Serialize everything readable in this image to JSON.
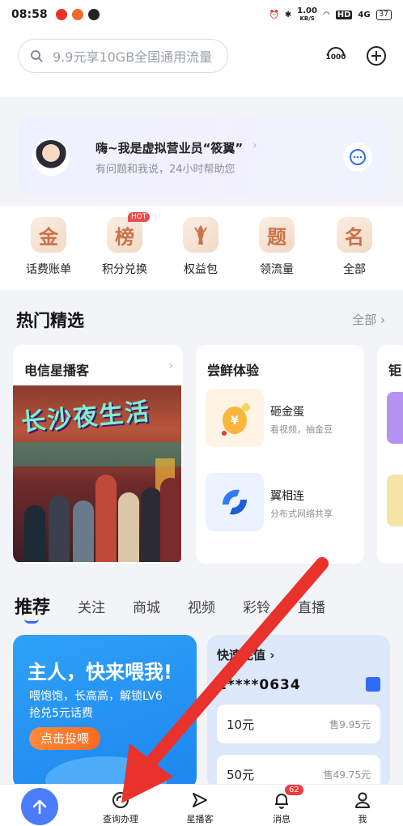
{
  "status_bar": {
    "time": "08:58",
    "network_speed": "1.00",
    "network_speed_unit": "KB/S",
    "hd": "HD",
    "signal": "4G",
    "battery": "37"
  },
  "search": {
    "placeholder": "9.9元享10GB全国通用流量"
  },
  "header": {
    "service_icon": "10000-service-icon",
    "add_icon": "plus-circle-icon"
  },
  "assistant": {
    "title": "嗨~我是虚拟营业员“筱翼”",
    "subtitle": "有问题和我说，24小时帮助您"
  },
  "quick_links": [
    {
      "label": "话费账单",
      "glyph": "金"
    },
    {
      "label": "积分兑换",
      "glyph": "榜",
      "badge": "HOT"
    },
    {
      "label": "权益包",
      "glyph": ""
    },
    {
      "label": "领流量",
      "glyph": "题"
    },
    {
      "label": "全部",
      "glyph": "名"
    }
  ],
  "hot_picks": {
    "title": "热门精选",
    "more": "全部",
    "cards": [
      {
        "title": "电信星播客",
        "poster_title": "长沙夜生活"
      },
      {
        "title": "尝鲜体验",
        "items": [
          {
            "name": "砸金蛋",
            "desc": "看视频，抽金豆"
          },
          {
            "name": "翼相连",
            "desc": "分布式网络共享"
          }
        ]
      },
      {
        "title": "钜"
      }
    ]
  },
  "tabs": [
    "推荐",
    "关注",
    "商城",
    "视频",
    "彩铃",
    "直播"
  ],
  "promo": {
    "title": "主人，快来喂我!",
    "line1": "喂饱饱，长高高，解锁LV6",
    "line2": "抢兑5元话费",
    "button": "点击投喂"
  },
  "recharge": {
    "title": "快速充值",
    "number": "1****0634",
    "options": [
      {
        "amount": "10元",
        "price": "售9.95元"
      },
      {
        "amount": "50元",
        "price": "售49.75元"
      }
    ]
  },
  "bottom_nav": [
    {
      "label": "查询办理"
    },
    {
      "label": "星播客"
    },
    {
      "label": "消息",
      "badge": "62"
    },
    {
      "label": "我"
    }
  ],
  "colors": {
    "accent": "#2f6cf6",
    "arrow": "#e8322b",
    "promo_bg": "#1d86ef",
    "hot_badge": "#ef4a4a"
  }
}
